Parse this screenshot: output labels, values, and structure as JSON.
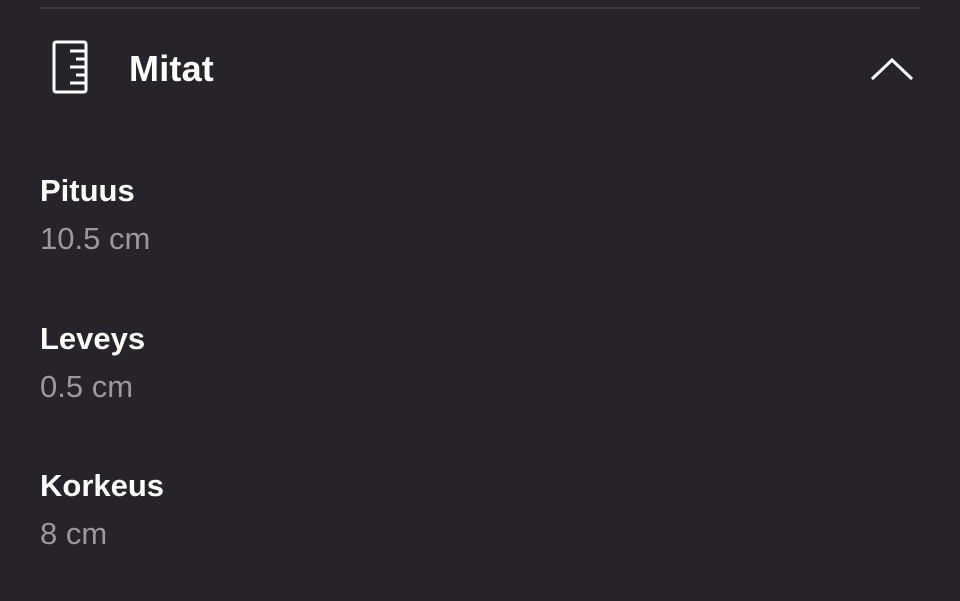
{
  "section": {
    "title": "Mitat",
    "icon": "ruler-icon",
    "collapse_icon": "chevron-up-icon",
    "expanded": true
  },
  "dimensions": [
    {
      "label": "Pituus",
      "value": "10.5 cm"
    },
    {
      "label": "Leveys",
      "value": "0.5 cm"
    },
    {
      "label": "Korkeus",
      "value": "8 cm"
    }
  ],
  "colors": {
    "background": "#262428",
    "label": "#ffffff",
    "value": "#9a989c",
    "divider": "#3b393d"
  }
}
